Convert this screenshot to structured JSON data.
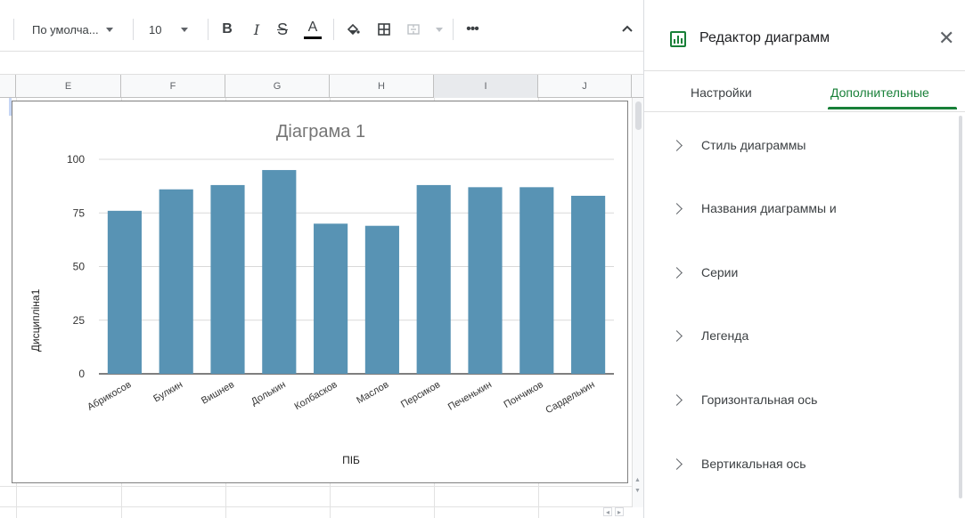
{
  "toolbar": {
    "font_name": "По умолча...",
    "font_size": "10",
    "bold_label": "B",
    "italic_label": "I",
    "strike_label": "S",
    "text_color_label": "A",
    "fill_icon": "paint-bucket-icon",
    "borders_icon": "borders-icon",
    "merge_icon": "merge-cells-icon",
    "more_label": "•••",
    "collapse_icon": "chevron-up-icon"
  },
  "columns": [
    {
      "label": "E",
      "selected": false
    },
    {
      "label": "F",
      "selected": false
    },
    {
      "label": "G",
      "selected": false
    },
    {
      "label": "H",
      "selected": false
    },
    {
      "label": "I",
      "selected": true
    },
    {
      "label": "J",
      "selected": false
    }
  ],
  "chart_data": {
    "type": "bar",
    "title": "Діаграма 1",
    "xlabel": "ПІБ",
    "ylabel": "Дисципліна1",
    "ylim": [
      0,
      100
    ],
    "yticks": [
      0,
      25,
      50,
      75,
      100
    ],
    "grid": true,
    "legend": "none",
    "color": "#5893b4",
    "categories": [
      "Абрикосов",
      "Булкин",
      "Вишнев",
      "Долькин",
      "Колбасков",
      "Маслов",
      "Персиков",
      "Печенькин",
      "Пончиков",
      "Сарделькин"
    ],
    "values": [
      76,
      86,
      88,
      95,
      70,
      69,
      88,
      87,
      87,
      83
    ]
  },
  "panel": {
    "title": "Редактор диаграмм",
    "close_label": "✕",
    "tabs": [
      {
        "label": "Настройки",
        "active": false
      },
      {
        "label": "Дополнительные",
        "active": true
      }
    ],
    "sections": [
      {
        "label": "Стиль диаграммы"
      },
      {
        "label": "Названия диаграммы и"
      },
      {
        "label": "Серии"
      },
      {
        "label": "Легенда"
      },
      {
        "label": "Горизонтальная ось"
      },
      {
        "label": "Вертикальная ось"
      }
    ],
    "accent": "#188038"
  }
}
